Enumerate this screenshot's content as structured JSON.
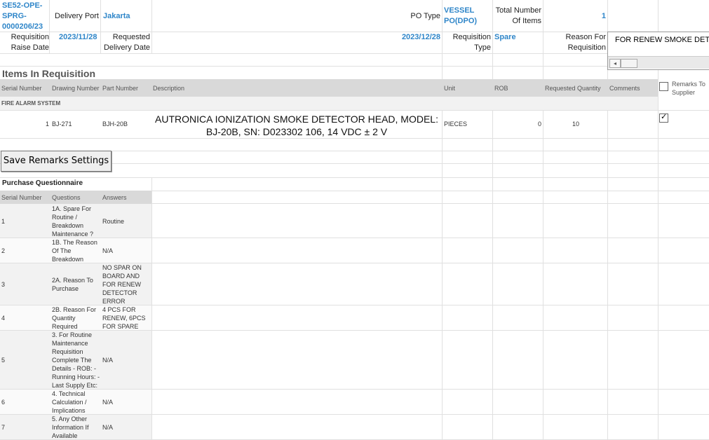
{
  "header": {
    "req_no": "SE52-OPE-SPRG-0000206/23",
    "delivery_port_label": "Delivery Port",
    "delivery_port": "Jakarta",
    "po_type_label": "PO Type",
    "po_type": "VESSEL PO(DPO)",
    "total_items_label": "Total Number Of Items",
    "total_items": "1",
    "raise_date_label": "Requisition Raise Date",
    "raise_date": "2023/11/28",
    "requested_date_label": "Requested Delivery Date",
    "requested_date": "2023/12/28",
    "req_type_label": "Requisition Type",
    "req_type": "Spare",
    "reason_label": "Reason For Requisition",
    "reason_value": "FOR RENEW SMOKE DETECTOR"
  },
  "items_section": {
    "title": "Items In Requisition",
    "columns": [
      "Serial Number",
      "Drawing Number",
      "Part Number",
      "Description",
      "Unit",
      "ROB",
      "Requested Quantity",
      "Comments",
      "Remarks To Supplier"
    ],
    "group": "FIRE ALARM SYSTEM",
    "rows": [
      {
        "serial": "1",
        "drawing": "BJ-271",
        "part": "BJH-20B",
        "description": "AUTRONICA IONIZATION SMOKE DETECTOR HEAD, MODEL: BJ-20B, SN: D023302 106, 14 VDC ± 2 V",
        "unit": "PIECES",
        "rob": "0",
        "qty": "10"
      }
    ]
  },
  "save_button": "Save Remarks Settings",
  "questionnaire": {
    "title": "Purchase Questionnaire",
    "columns": [
      "Serial Number",
      "Questions",
      "Answers"
    ],
    "rows": [
      {
        "serial": "1",
        "question": "1A. Spare For Routine / Breakdown Maintenance ?",
        "answer": "Routine"
      },
      {
        "serial": "2",
        "question": "1B. The Reason Of The Breakdown",
        "answer": "N/A"
      },
      {
        "serial": "3",
        "question": "2A. Reason To Purchase",
        "answer": "NO SPAR ON BOARD AND FOR RENEW DETECTOR ERROR"
      },
      {
        "serial": "4",
        "question": "2B. Reason For Quantity Required",
        "answer": "4 PCS FOR RENEW, 6PCS FOR SPARE"
      },
      {
        "serial": "5",
        "question": "3. For Routine Maintenance Requisition Complete The Details - ROB: - Running Hours: - Last Supply Etc:",
        "answer": "N/A"
      },
      {
        "serial": "6",
        "question": "4. Technical Calculation / Implications",
        "answer": "N/A"
      },
      {
        "serial": "7",
        "question": "5. Any Other Information If Available",
        "answer": "N/A"
      }
    ]
  }
}
